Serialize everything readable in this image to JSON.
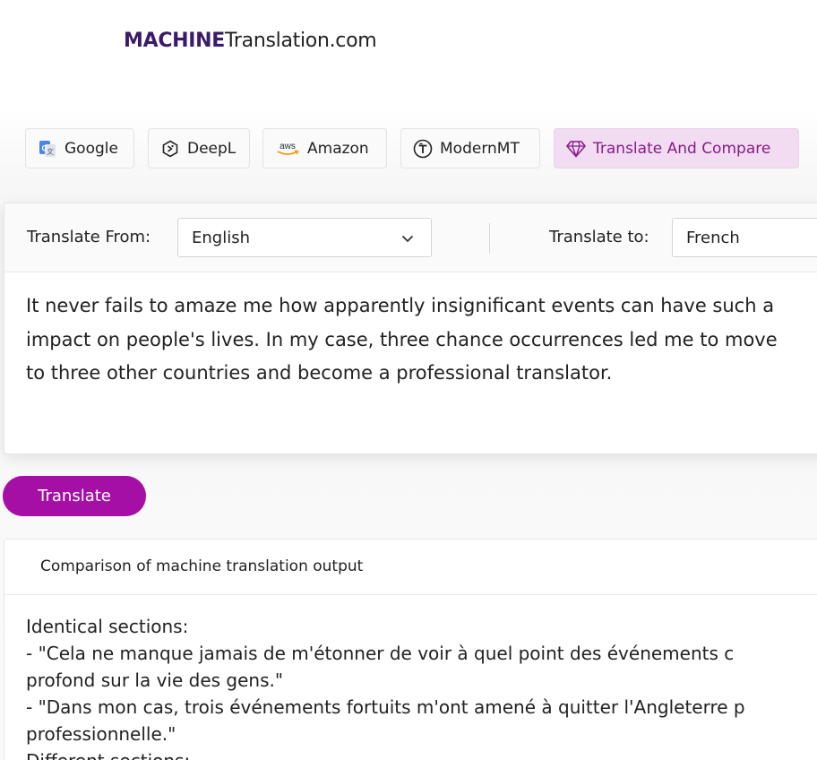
{
  "logo": {
    "strong": "MACHINE",
    "light": "Translation.com"
  },
  "tabs": [
    {
      "label": "Google",
      "icon": "google-translate-icon"
    },
    {
      "label": "DeepL",
      "icon": "deepl-icon"
    },
    {
      "label": "Amazon",
      "icon": "aws-icon"
    },
    {
      "label": "ModernMT",
      "icon": "modernmt-icon"
    },
    {
      "label": "Translate And Compare",
      "icon": "diamond-icon"
    }
  ],
  "colors": {
    "brand": "#3b1a6b",
    "accent": "#a60fa6",
    "active_tab_bg": "#f1dcf1",
    "active_tab_text": "#8a1b8a"
  },
  "translator": {
    "from_label": "Translate From:",
    "from_value": "English",
    "to_label": "Translate to:",
    "to_value": "French",
    "source_lines": [
      "It never fails to amaze me how apparently insignificant events can have such a",
      "impact on people's lives. In my case, three chance occurrences led me to move",
      "to three other countries and become a professional translator."
    ]
  },
  "translate_button": "Translate",
  "comparison": {
    "title": "Comparison of machine translation output",
    "lines": [
      "Identical sections:",
      "- \"Cela ne manque jamais de m'étonner de voir à quel point des événements c",
      "profond sur la vie des gens.\"",
      "- \"Dans mon cas, trois événements fortuits m'ont amené à quitter l'Angleterre p",
      "professionnelle.\"",
      "Different sections:"
    ]
  }
}
